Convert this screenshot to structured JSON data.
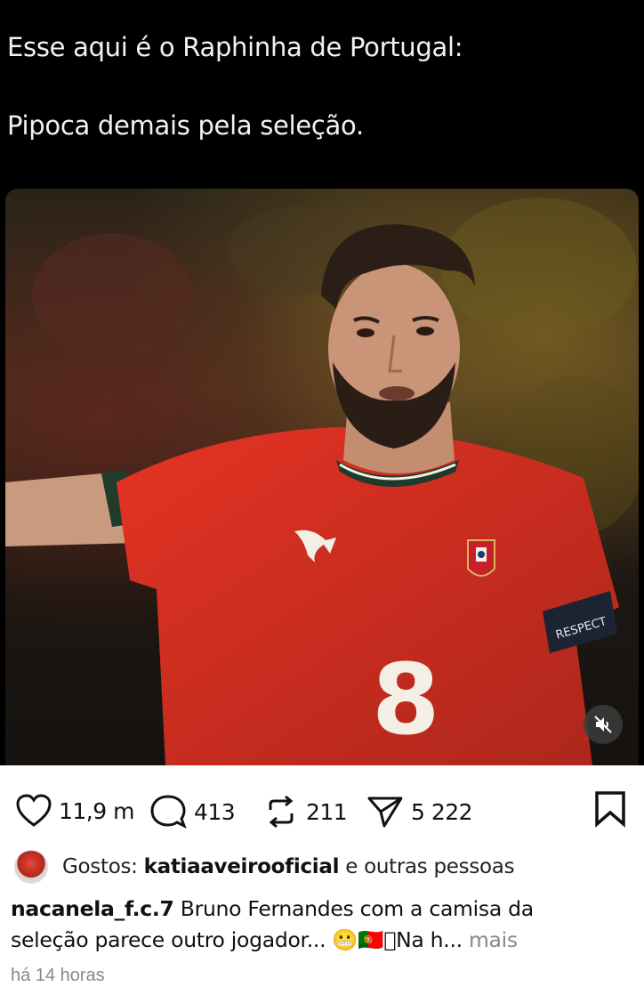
{
  "tweet": {
    "line1": "Esse aqui é o Raphinha de Portugal:",
    "line2": "Pipoca demais pela seleção."
  },
  "post": {
    "actions": {
      "likes": "11,9 m",
      "comments": "413",
      "reposts": "211",
      "shares": "5 222"
    },
    "liked_by": {
      "prefix": "Gostos:",
      "user": "katiaaveirooficial",
      "suffix": "e outras pessoas"
    },
    "caption": {
      "username": "nacanela_f.c.7",
      "text_line1": "Bruno Fernandes com a camisa da",
      "text_line2": "seleção parece outro jogador... 😬🇵🇹􀀀Na h...",
      "more": "mais"
    },
    "timestamp": "há 14 horas"
  },
  "media": {
    "jersey_text": "RESPECT",
    "number": "8"
  },
  "icons": {
    "like": "heart-icon",
    "comment": "comment-icon",
    "repost": "repost-icon",
    "share": "send-icon",
    "bookmark": "bookmark-icon",
    "mute": "speaker-muted-icon"
  }
}
